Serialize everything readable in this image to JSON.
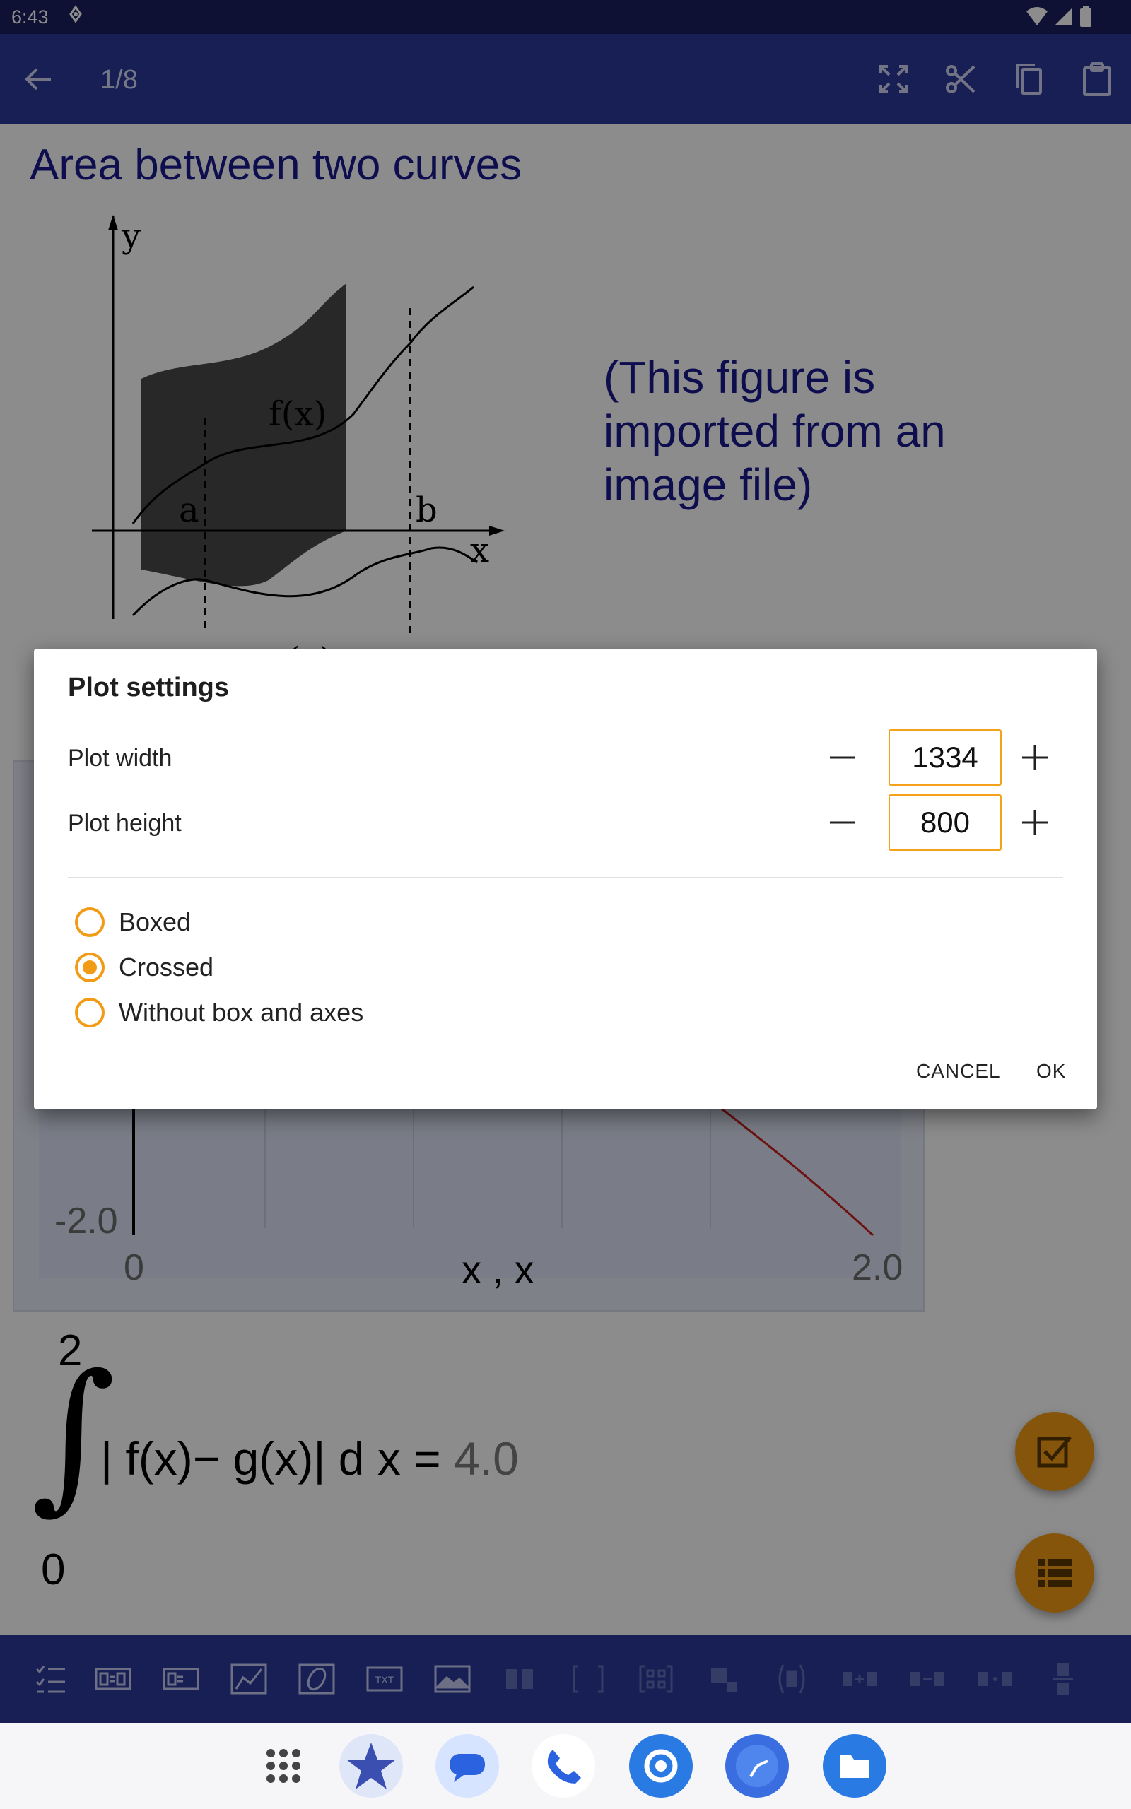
{
  "status_bar": {
    "time": "6:43"
  },
  "app_bar": {
    "page_indicator": "1/8"
  },
  "document": {
    "title": "Area between two curves",
    "figure_labels": {
      "y": "y",
      "x": "x",
      "fx": "f(x)",
      "gx": "g(x)",
      "a": "a",
      "b": "b"
    },
    "figure_note": "(This figure is imported from an image file)",
    "plot": {
      "y_tick_bottom": "-2.0",
      "x_tick_left": "0",
      "x_tick_right": "2.0",
      "x_label": "x , x"
    },
    "integral": {
      "upper": "2",
      "lower": "0",
      "expression": "| f(x)− g(x)| d x = ",
      "result": "4.0"
    }
  },
  "dialog": {
    "title": "Plot settings",
    "width_label": "Plot width",
    "width_value": "1334",
    "height_label": "Plot height",
    "height_value": "800",
    "options": [
      {
        "label": "Boxed",
        "checked": false
      },
      {
        "label": "Crossed",
        "checked": true
      },
      {
        "label": "Without box and axes",
        "checked": false
      }
    ],
    "cancel_label": "CANCEL",
    "ok_label": "OK"
  },
  "colors": {
    "primary": "#2b3a9c",
    "status_bar": "#1a1f5e",
    "accent": "#f29b16",
    "title_text": "#1a1a90"
  }
}
